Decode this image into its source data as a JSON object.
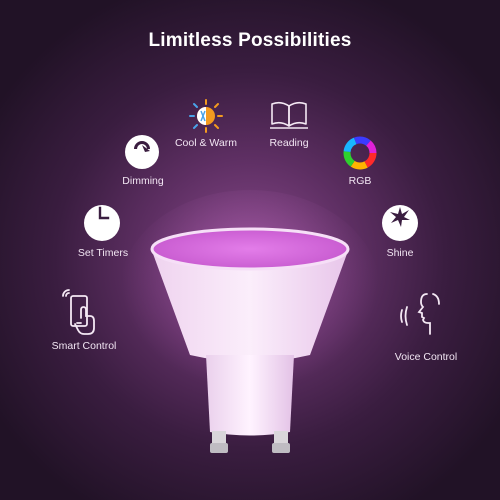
{
  "title": "Limitless Possibilities",
  "features": {
    "cool_warm": {
      "label": "Cool & Warm",
      "icon": "sun-snowflake-icon"
    },
    "reading": {
      "label": "Reading",
      "icon": "open-book-icon"
    },
    "dimming": {
      "label": "Dimming",
      "icon": "dimmer-icon"
    },
    "rgb": {
      "label": "RGB",
      "icon": "rgb-ring-icon"
    },
    "set_timers": {
      "label": "Set Timers",
      "icon": "clock-icon"
    },
    "shine": {
      "label": "Shine",
      "icon": "star-burst-icon"
    },
    "smart_control": {
      "label": "Smart Control",
      "icon": "phone-tap-icon"
    },
    "voice_control": {
      "label": "Voice Control",
      "icon": "voice-head-icon"
    }
  },
  "colors": {
    "background_center": "#8a4a8c",
    "background_edge": "#211226",
    "bulb_glow": "#e07be6",
    "text": "#ffffff"
  }
}
